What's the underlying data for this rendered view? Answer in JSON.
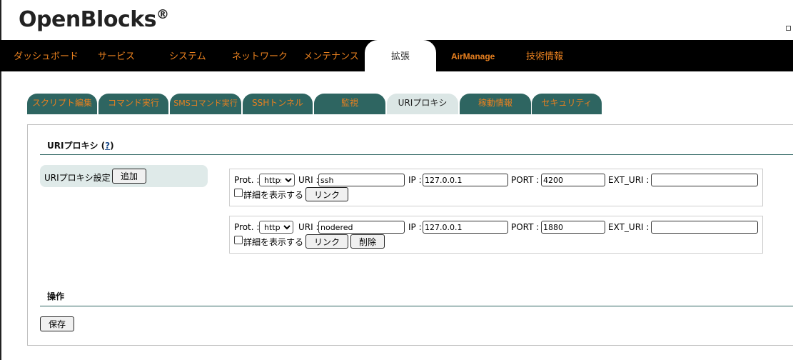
{
  "brand": {
    "name": "OpenBlocks",
    "reg": "®"
  },
  "main_nav": [
    {
      "label": "ダッシュボード"
    },
    {
      "label": "サービス"
    },
    {
      "label": "システム"
    },
    {
      "label": "ネットワーク"
    },
    {
      "label": "メンテナンス"
    },
    {
      "label": "拡張"
    },
    {
      "label": "AirManage"
    },
    {
      "label": "技術情報"
    }
  ],
  "sub_tabs": [
    {
      "label": "スクリプト編集"
    },
    {
      "label": "コマンド実行"
    },
    {
      "label": "SMSコマンド実行"
    },
    {
      "label": "SSHトンネル"
    },
    {
      "label": "監視"
    },
    {
      "label": "URIプロキシ"
    },
    {
      "label": "稼動情報"
    },
    {
      "label": "セキュリティ"
    }
  ],
  "section": {
    "title": "URIプロキシ (",
    "help": "?",
    "close": ")"
  },
  "setting": {
    "label": "URIプロキシ設定",
    "add_button": "追加"
  },
  "row_labels": {
    "prot": "Prot. :",
    "uri": "URI :",
    "ip": "IP :",
    "port": "PORT :",
    "ext_uri": "EXT_URI :",
    "detail": "詳細を表示する",
    "link": "リンク",
    "delete": "削除"
  },
  "rows": [
    {
      "prot": "https",
      "uri": "ssh",
      "ip": "127.0.0.1",
      "port": "4200",
      "ext_uri": ""
    },
    {
      "prot": "http",
      "uri": "nodered",
      "ip": "127.0.0.1",
      "port": "1880",
      "ext_uri": ""
    }
  ],
  "operation": {
    "title": "操作",
    "save_button": "保存"
  },
  "colors": {
    "nav_bg": "#000000",
    "accent_orange": "#e8801f",
    "tab_teal": "#2e6561",
    "tab_active": "#dbe6e5"
  }
}
